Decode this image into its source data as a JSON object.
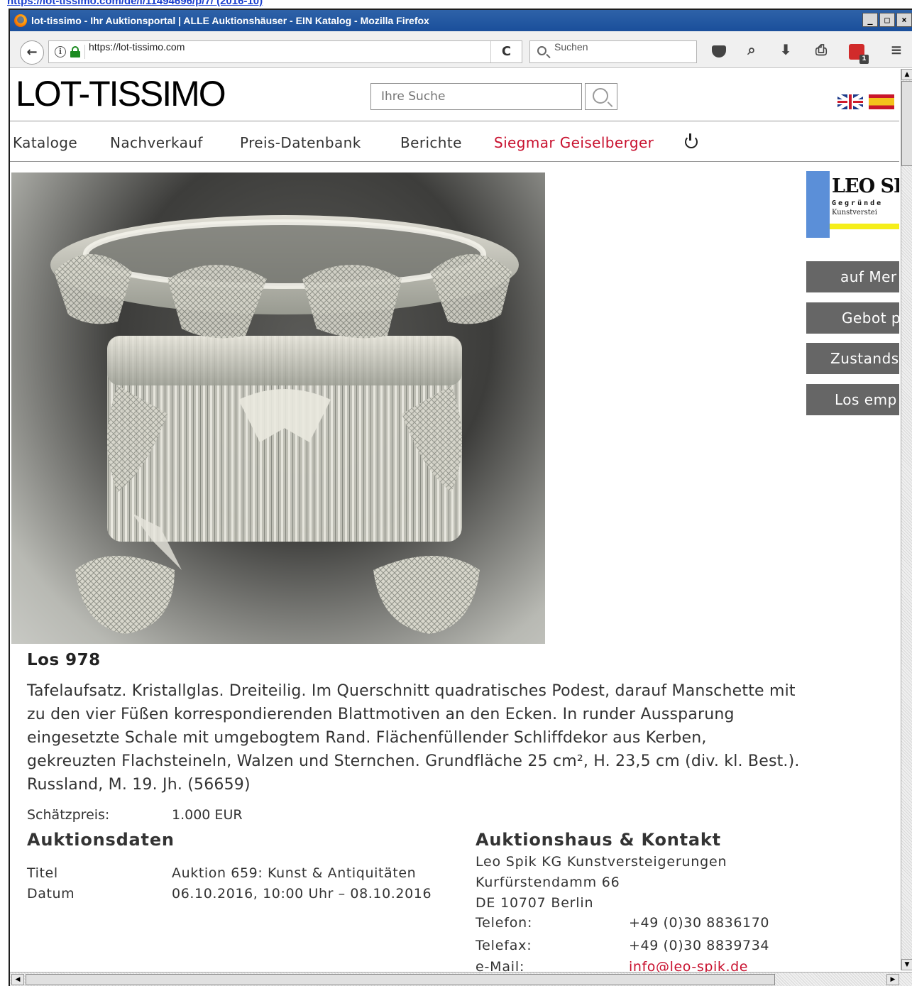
{
  "screenshot_url": "https://lot-tissimo.com/de/i/11494696/p/7/ (2016-10)",
  "window": {
    "title": "lot-tissimo - Ihr Auktionsportal | ALLE Auktionshäuser - EIN Katalog - Mozilla Firefox",
    "btn_min": "_",
    "btn_max": "□",
    "btn_close": "×"
  },
  "browser": {
    "url": "https://lot-tissimo.com",
    "search_placeholder": "Suchen",
    "back_glyph": "←",
    "reload_glyph": "C",
    "zoom_glyph": "⌕",
    "download_glyph": "⬇",
    "print_glyph": "⎙",
    "menu_glyph": "≡"
  },
  "site": {
    "logo": "LOT-TISSIMO",
    "search_placeholder": "Ihre Suche",
    "nav": {
      "kataloge": "Kataloge",
      "nachverkauf": "Nachverkauf",
      "preis": "Preis-Datenbank",
      "berichte": "Berichte",
      "user": "Siegmar Geiselberger"
    }
  },
  "sidebar": {
    "logo_name": "LEO SP",
    "logo_sub1": "Gegründe",
    "logo_sub2": "Kunstverstei",
    "buttons": [
      "auf Mer",
      "Gebot p",
      "Zustands",
      "Los emp"
    ]
  },
  "lot": {
    "title": "Los 978",
    "description": "Tafelaufsatz. Kristallglas. Dreiteilig. Im Querschnitt quadratisches Podest, darauf Manschette mit zu den vier Füßen korrespondierenden Blattmotiven an den Ecken. In runder Aussparung eingesetzte Schale mit umgebogtem Rand. Flächenfüllender Schliffdekor aus Kerben, gekreuzten Flachsteineln, Walzen und Sternchen. Grundfläche 25 cm², H. 23,5 cm (div. kl. Best.). Russland, M. 19. Jh. (56659)",
    "estimate_label": "Schätzpreis:",
    "estimate_value": "1.000 EUR"
  },
  "auktionsdaten": {
    "heading": "Auktionsdaten",
    "titel_label": "Titel",
    "titel_value": "Auktion 659: Kunst & Antiquitäten",
    "datum_label": "Datum",
    "datum_value": "06.10.2016, 10:00 Uhr – 08.10.2016"
  },
  "kontakt": {
    "heading": "Auktionshaus & Kontakt",
    "name": "Leo Spik KG Kunstversteigerungen",
    "street": "Kurfürstendamm 66",
    "city": "DE 10707 Berlin",
    "telefon_label": "Telefon:",
    "telefon_value": "+49 (0)30 8836170",
    "telefax_label": "Telefax:",
    "telefax_value": "+49 (0)30 8839734",
    "email_label": "e-Mail:",
    "email_value": "info@leo-spik.de"
  },
  "colors": {
    "titlebar": "#1a4f9b",
    "accent_red": "#c8102e",
    "side_button": "#666666",
    "sidebar_logo_blue": "#5b8fd8",
    "sidebar_logo_yellow": "#f5ee1a"
  }
}
